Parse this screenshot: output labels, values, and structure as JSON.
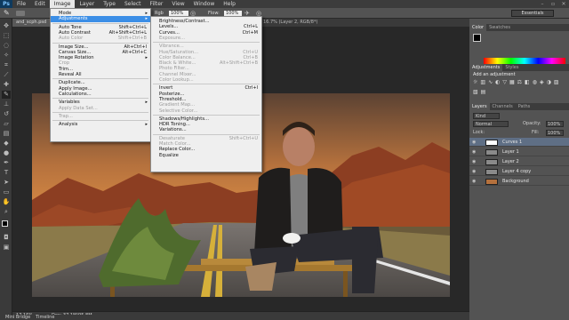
{
  "app": {
    "logo": "Ps"
  },
  "menubar": {
    "items": [
      "File",
      "Edit",
      "Image",
      "Layer",
      "Type",
      "Select",
      "Filter",
      "View",
      "Window",
      "Help"
    ],
    "active_index": 2
  },
  "options": {
    "partial_rgb": "Rgb",
    "opacity_pct": "100%",
    "flow_label": "Flow:",
    "flow_pct": "100%",
    "workspace": "Essentials"
  },
  "tabs": {
    "doc": "and_scph.psd",
    "doc_right": "16.7% (Layer 2, RGB/8*)",
    "close_glyph": "×"
  },
  "image_menu": {
    "items": [
      {
        "label": "Mode",
        "shortcut": "",
        "arrow": true,
        "disabled": false
      },
      {
        "label": "Adjustments",
        "shortcut": "",
        "arrow": true,
        "disabled": false,
        "highlight": true
      },
      {
        "sep": true
      },
      {
        "label": "Auto Tone",
        "shortcut": "Shift+Ctrl+L",
        "disabled": false
      },
      {
        "label": "Auto Contrast",
        "shortcut": "Alt+Shift+Ctrl+L",
        "disabled": false
      },
      {
        "label": "Auto Color",
        "shortcut": "Shift+Ctrl+B",
        "disabled": true
      },
      {
        "sep": true
      },
      {
        "label": "Image Size...",
        "shortcut": "Alt+Ctrl+I",
        "disabled": false
      },
      {
        "label": "Canvas Size...",
        "shortcut": "Alt+Ctrl+C",
        "disabled": false
      },
      {
        "label": "Image Rotation",
        "shortcut": "",
        "arrow": true,
        "disabled": false
      },
      {
        "label": "Crop",
        "shortcut": "",
        "disabled": true
      },
      {
        "label": "Trim...",
        "shortcut": "",
        "disabled": false
      },
      {
        "label": "Reveal All",
        "shortcut": "",
        "disabled": false
      },
      {
        "sep": true
      },
      {
        "label": "Duplicate...",
        "shortcut": "",
        "disabled": false
      },
      {
        "label": "Apply Image...",
        "shortcut": "",
        "disabled": false
      },
      {
        "label": "Calculations...",
        "shortcut": "",
        "disabled": false
      },
      {
        "sep": true
      },
      {
        "label": "Variables",
        "shortcut": "",
        "arrow": true,
        "disabled": false
      },
      {
        "label": "Apply Data Set...",
        "shortcut": "",
        "disabled": true
      },
      {
        "sep": true
      },
      {
        "label": "Trap...",
        "shortcut": "",
        "disabled": true
      },
      {
        "sep": true
      },
      {
        "label": "Analysis",
        "shortcut": "",
        "arrow": true,
        "disabled": false
      }
    ]
  },
  "adjust_menu": {
    "items": [
      {
        "label": "Brightness/Contrast...",
        "shortcut": "",
        "disabled": false
      },
      {
        "label": "Levels...",
        "shortcut": "Ctrl+L",
        "disabled": false
      },
      {
        "label": "Curves...",
        "shortcut": "Ctrl+M",
        "disabled": false
      },
      {
        "label": "Exposure...",
        "shortcut": "",
        "disabled": true
      },
      {
        "sep": true
      },
      {
        "label": "Vibrance...",
        "shortcut": "",
        "disabled": true
      },
      {
        "label": "Hue/Saturation...",
        "shortcut": "Ctrl+U",
        "disabled": true
      },
      {
        "label": "Color Balance...",
        "shortcut": "Ctrl+B",
        "disabled": true
      },
      {
        "label": "Black & White...",
        "shortcut": "Alt+Shift+Ctrl+B",
        "disabled": true
      },
      {
        "label": "Photo Filter...",
        "shortcut": "",
        "disabled": true
      },
      {
        "label": "Channel Mixer...",
        "shortcut": "",
        "disabled": true
      },
      {
        "label": "Color Lookup...",
        "shortcut": "",
        "disabled": true
      },
      {
        "sep": true
      },
      {
        "label": "Invert",
        "shortcut": "Ctrl+I",
        "disabled": false
      },
      {
        "label": "Posterize...",
        "shortcut": "",
        "disabled": false
      },
      {
        "label": "Threshold...",
        "shortcut": "",
        "disabled": false
      },
      {
        "label": "Gradient Map...",
        "shortcut": "",
        "disabled": true
      },
      {
        "label": "Selective Color...",
        "shortcut": "",
        "disabled": true
      },
      {
        "sep": true
      },
      {
        "label": "Shadows/Highlights...",
        "shortcut": "",
        "disabled": false
      },
      {
        "label": "HDR Toning...",
        "shortcut": "",
        "disabled": false
      },
      {
        "label": "Variations...",
        "shortcut": "",
        "disabled": false
      },
      {
        "sep": true
      },
      {
        "label": "Desaturate",
        "shortcut": "Shift+Ctrl+U",
        "disabled": true
      },
      {
        "label": "Match Color...",
        "shortcut": "",
        "disabled": true
      },
      {
        "label": "Replace Color...",
        "shortcut": "",
        "disabled": false
      },
      {
        "label": "Equalize",
        "shortcut": "",
        "disabled": false
      }
    ]
  },
  "color_panel": {
    "tabs": [
      "Color",
      "Swatches"
    ]
  },
  "adjust_panel": {
    "tabs": [
      "Adjustments",
      "Styles"
    ],
    "heading": "Add an adjustment"
  },
  "layers_panel": {
    "tabs": [
      "Layers",
      "Channels",
      "Paths"
    ],
    "filter_label": "Kind",
    "blend_mode": "Normal",
    "opacity_label": "Opacity:",
    "opacity": "100%",
    "lock_label": "Lock:",
    "fill_label": "Fill:",
    "fill": "100%",
    "layers": [
      {
        "name": "Curves 1",
        "selected": true
      },
      {
        "name": "Layer 1",
        "selected": false
      },
      {
        "name": "Layer 2",
        "selected": false
      },
      {
        "name": "Layer 4 copy",
        "selected": false
      },
      {
        "name": "Background",
        "selected": false
      }
    ]
  },
  "status": {
    "zoom": "17.16%",
    "doc": "Doc: 37.1M/95.8M"
  },
  "bottom_tabs": [
    "Mini Bridge",
    "Timeline"
  ],
  "colors": {
    "highlight": "#3b8ee6",
    "menubar": "#3c3c3c",
    "panel": "#535353"
  }
}
